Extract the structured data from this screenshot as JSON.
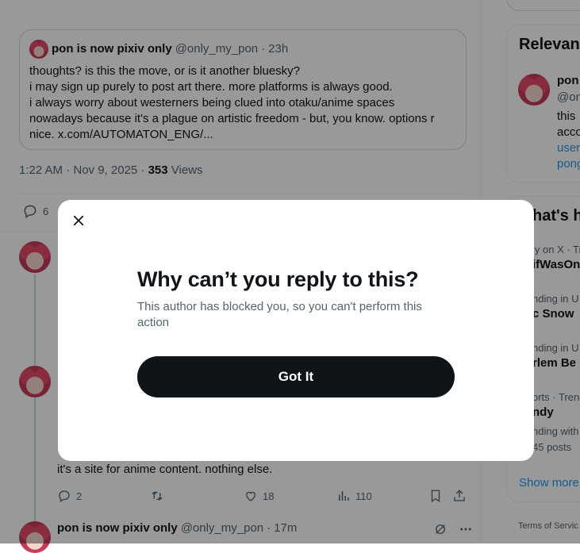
{
  "quote": {
    "display_name": "pon is now pixiv only",
    "handle": "@only_my_pon",
    "separator": "·",
    "time": "23h",
    "text": "thoughts? is this the move, or is it another bluesky?\ni may sign up purely to post art there. more platforms is always good.\ni always worry about westerners being clued into otaku/anime spaces\nnowadays because it's a plague on artistic freedom - but, you know. options r\nnice. x.com/AUTOMATON_ENG/..."
  },
  "post_meta": {
    "timestamp": "1:22 AM · Nov 9, 2025 ·",
    "views_count": "353",
    "views_label": "Views"
  },
  "post_actions": {
    "reply_count": "6"
  },
  "reply2": {
    "text": "it's a site for anime content. nothing else.",
    "replies": "2",
    "likes": "18",
    "views": "110"
  },
  "reply3": {
    "display_name": "pon is now pixiv only",
    "handle": "@only_my_pon",
    "separator": "·",
    "time": "17m"
  },
  "sidebar": {
    "relevant_title": "Relevan",
    "rel_name": "pon",
    "rel_handle": "@on",
    "rel_bio1": "this",
    "rel_bio2": "acco",
    "rel_link1": "user",
    "rel_link2": "pong",
    "whats_title": "hat's h",
    "trends": [
      {
        "meta": "ly on X · Tr",
        "name": "ifWasOn"
      },
      {
        "meta": "nding in U",
        "name": "c Snow"
      },
      {
        "meta": "nding in U",
        "name": "rlem Be"
      },
      {
        "meta": "orts · Trend",
        "name": "ndy"
      },
      {
        "meta": "nding with",
        "name": "45 posts"
      }
    ],
    "show_more": "Show more",
    "footer": "Terms of Servic"
  },
  "modal": {
    "title": "Why can’t you reply to this?",
    "body": "This author has blocked you, so you can't perform this action",
    "button": "Got It"
  },
  "colors": {
    "primary_text": "#0f1419",
    "secondary_text": "#536471",
    "accent": "#1d9bf0",
    "button_bg": "#0f1419",
    "overlay": "rgba(0,0,0,0.4)"
  },
  "icons": [
    "close-icon",
    "reply-icon",
    "retweet-icon",
    "like-icon",
    "views-icon",
    "bookmark-icon",
    "share-icon",
    "grok-icon",
    "more-icon"
  ]
}
